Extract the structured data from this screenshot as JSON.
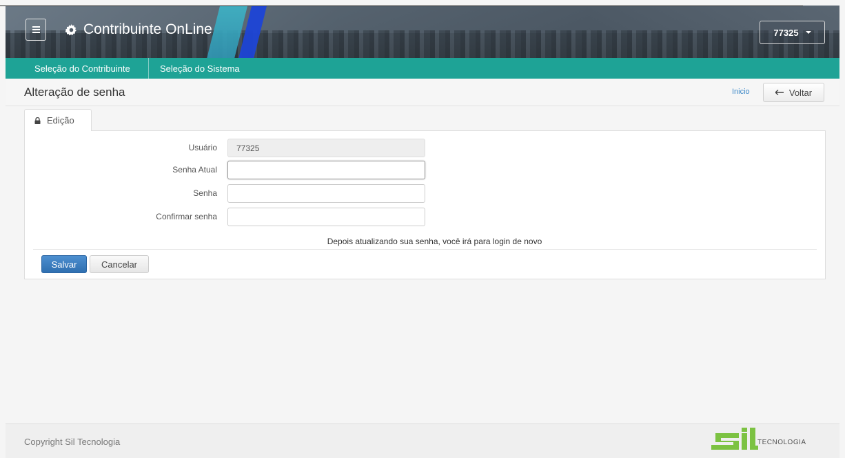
{
  "header": {
    "app_title": "Contribuinte OnLine",
    "user_menu_label": "77325",
    "menu_icon": "hamburger-icon",
    "title_icon": "gear-icon"
  },
  "nav": {
    "items": [
      {
        "label": "Seleção do Contribuinte"
      },
      {
        "label": "Seleção do Sistema"
      }
    ]
  },
  "page": {
    "title": "Alteração de senha",
    "home_link": "Inicio",
    "back_button": "Voltar"
  },
  "tab": {
    "label": "Edição",
    "icon": "lock-icon"
  },
  "form": {
    "usuario": {
      "label": "Usuário",
      "value": "77325"
    },
    "senha_atual": {
      "label": "Senha Atual",
      "value": ""
    },
    "senha": {
      "label": "Senha",
      "value": ""
    },
    "confirmar": {
      "label": "Confirmar senha",
      "value": ""
    },
    "notice": "Depois atualizando sua senha, você irá para login de novo",
    "save_label": "Salvar",
    "cancel_label": "Cancelar"
  },
  "footer": {
    "copyright": "Copyright Sil Tecnologia",
    "logo_text": "TECNOLOGIA"
  },
  "colors": {
    "nav_teal": "#1ea396",
    "primary_blue": "#3479bd",
    "logo_green": "#7cc242"
  }
}
